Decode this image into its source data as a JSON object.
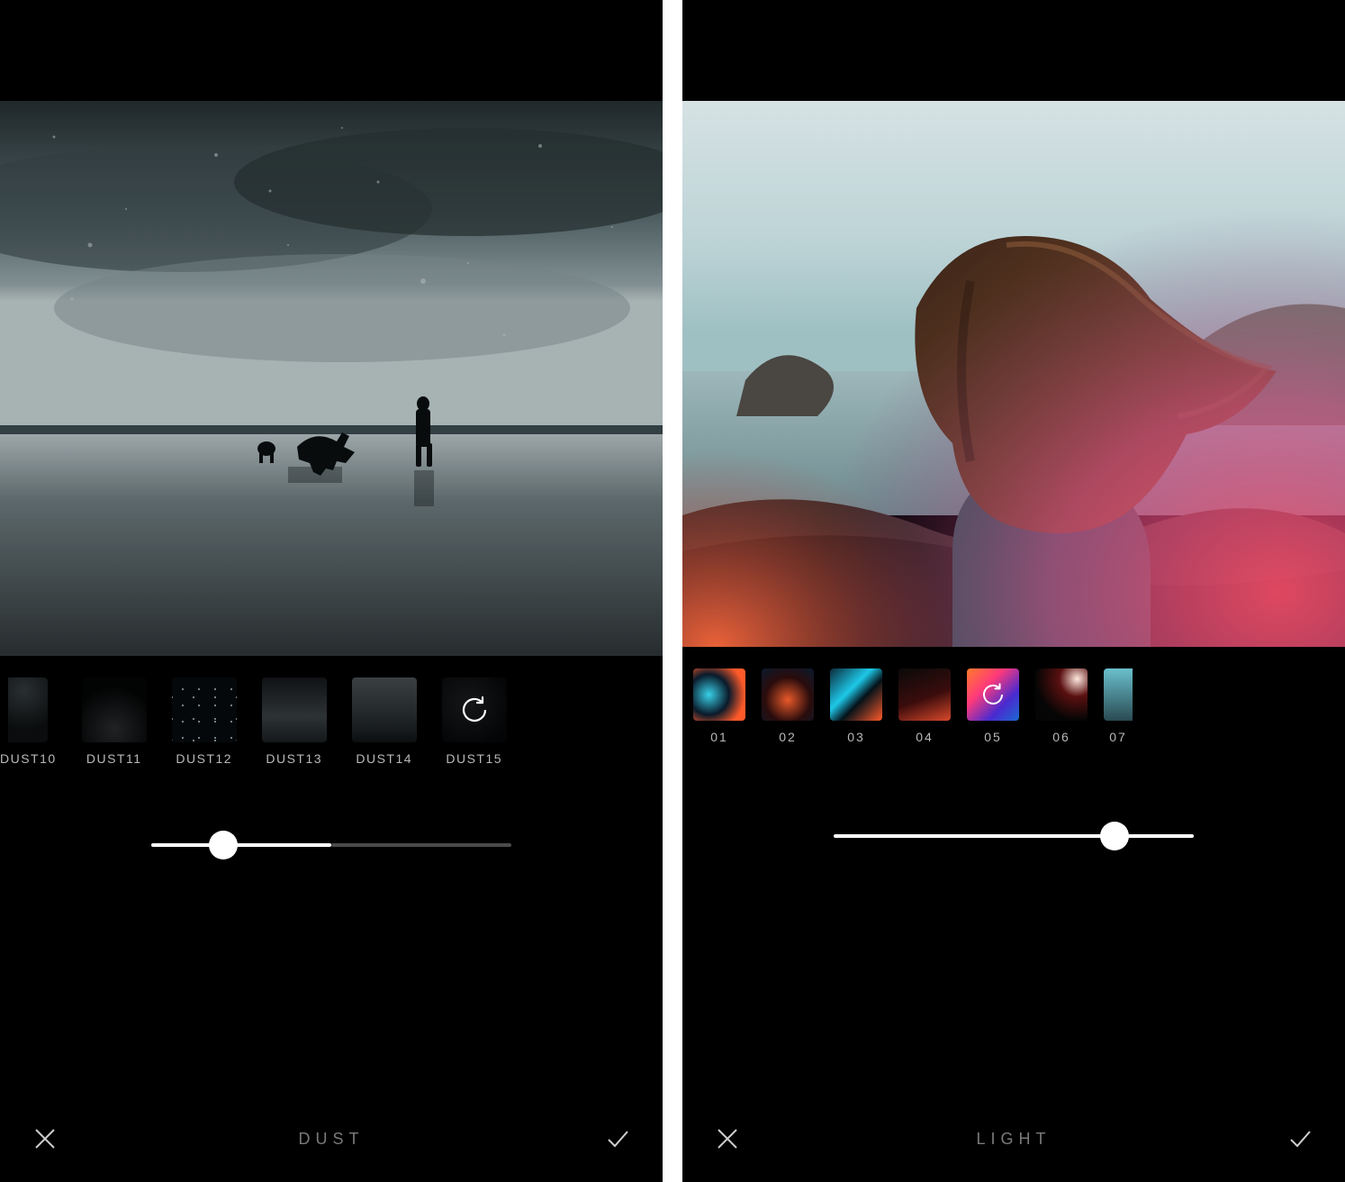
{
  "panels": [
    {
      "kind": "dust",
      "footer_title": "DUST",
      "slider_pos": 0.2,
      "thumbs": [
        {
          "label": "DUST10",
          "partial": true,
          "selected": false,
          "gradient": "dust10"
        },
        {
          "label": "DUST11",
          "partial": false,
          "selected": false,
          "gradient": "dust11"
        },
        {
          "label": "DUST12",
          "partial": false,
          "selected": false,
          "gradient": "dust12"
        },
        {
          "label": "DUST13",
          "partial": false,
          "selected": false,
          "gradient": "dust13"
        },
        {
          "label": "DUST14",
          "partial": false,
          "selected": false,
          "gradient": "dust14"
        },
        {
          "label": "DUST15",
          "partial": false,
          "selected": true,
          "gradient": "dust15"
        }
      ]
    },
    {
      "kind": "light",
      "footer_title": "LIGHT",
      "slider_pos": 0.78,
      "thumbs": [
        {
          "label": "01",
          "partial": false,
          "selected": false,
          "gradient": "lt01"
        },
        {
          "label": "02",
          "partial": false,
          "selected": false,
          "gradient": "lt02"
        },
        {
          "label": "03",
          "partial": false,
          "selected": false,
          "gradient": "lt03"
        },
        {
          "label": "04",
          "partial": false,
          "selected": false,
          "gradient": "lt04"
        },
        {
          "label": "05",
          "partial": false,
          "selected": true,
          "gradient": "lt05"
        },
        {
          "label": "06",
          "partial": false,
          "selected": false,
          "gradient": "lt06"
        },
        {
          "label": "07",
          "partial": true,
          "selected": false,
          "gradient": "lt07"
        }
      ]
    }
  ]
}
